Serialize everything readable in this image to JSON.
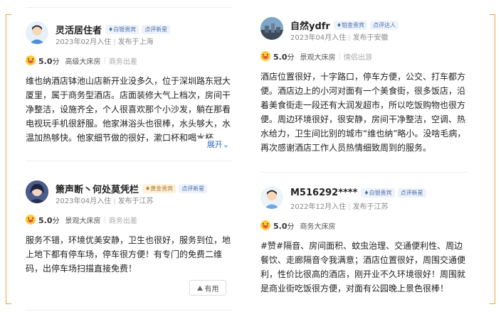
{
  "reviews": [
    {
      "name": "灵活居住者",
      "level_badge": "白银贵宾",
      "star_badge": "点评新星",
      "join": "2023年02月入住",
      "from": "发布于上海",
      "score": "5.0",
      "score_unit": "分",
      "room": "高级大床房",
      "purpose": "商务出差",
      "text": "维也纳酒店钵池山店新开业没多久，位于深圳路东冠大厦里，属于商务型酒店。店面装修大气上档次，房间干净整洁，设施齐全，个人很喜欢那个小沙发，躺在那看电视玩手机很舒服。他家淋浴头也很棒，水头够大，水温加热够快。他家细节做的很好，漱口杯和喝水杯",
      "expand": "展开"
    },
    {
      "name": "箫声断丶何处莫凭栏",
      "level_badge": "黄金贵宾",
      "star_badge": "点评新星",
      "join": "2023年04月入住",
      "from": "发布于江苏",
      "score": "5.0",
      "score_unit": "分",
      "room": "景观大床房",
      "purpose": "商务出差",
      "text": "服务不错，环境优美安静，卫生也很好，服务到位，地上地下都有停车场，停车很方便！有专门的免费二维码，出停车场扫描直接免费！",
      "useful": "有用"
    },
    {
      "name": "自然ydfr",
      "level_badge": "铂金贵宾",
      "star_badge": "点评达人",
      "join": "2023年04月入住",
      "from": "发布于安徽",
      "score": "5.0",
      "score_unit": "分",
      "room": "景观大床房",
      "purpose": "情侣出游",
      "text": "酒店位置很好，十字路口，停车方便，公交、打车都方便。酒店边上的小河对面有一个美食街，很多饭店，沿着美食街走一段还有大润发超市，所以吃饭购物也很方便。周边环境很好，很安静，房间干净整洁，空调、热水给力，卫生间比别的城市“维也纳”略小。没啥毛病，再次感谢酒店工作人员热情细致周到的服务。"
    },
    {
      "name": "M516292****",
      "level_badge": "白银贵宾",
      "star_badge": "点评新星",
      "join": "2022年12月入住",
      "from": "发布于江苏",
      "score": "5.0",
      "score_unit": "分",
      "room": "商务大床房",
      "purpose": "",
      "text": "#赞#隔音、房间面积、蚊虫治理、交通便利性、周边餐饮、走廊隔音令我满意；酒店位置很好，周围交通便利，性价比很高的酒店，刚开业不久环境很好！周围就是商业街吃饭很方便，对面有公园晚上景色很棒！"
    }
  ],
  "colors": {
    "accent_link": "#2f6ec8",
    "bracket": "#f0a040",
    "score_emoji": "#ffc93c"
  },
  "icons": {
    "silver_badge": "diamond-icon",
    "gold_badge": "diamond-icon",
    "useful": "thumb-icon",
    "expand": "chevron-down-icon"
  }
}
